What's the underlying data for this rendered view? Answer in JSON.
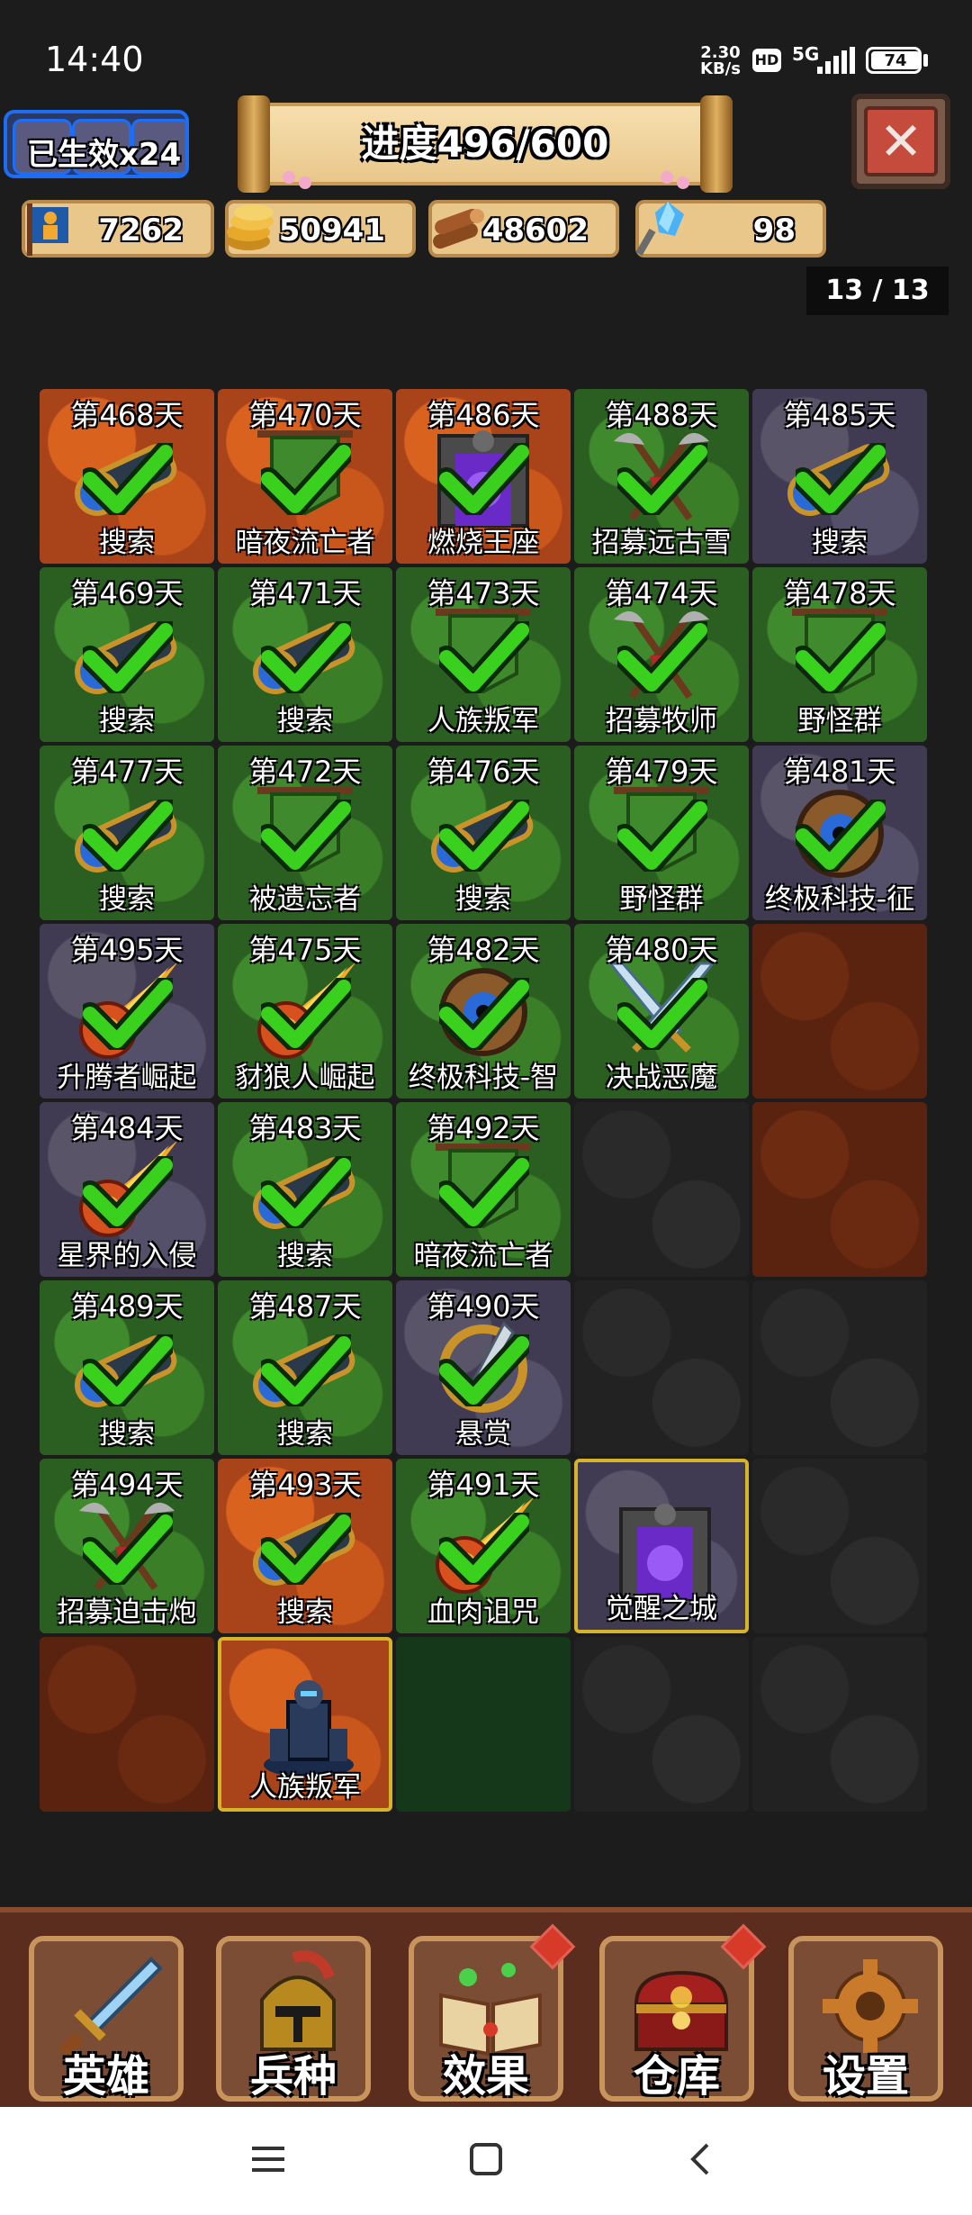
{
  "status_bar": {
    "time": "14:40",
    "net_speed_value": "2.30",
    "net_speed_unit": "KB/s",
    "hd": "HD",
    "network": "5G",
    "battery": "74"
  },
  "buffs": {
    "label": "已生效x24"
  },
  "progress": {
    "label": "进度496/600"
  },
  "resources": [
    {
      "icon": "population-icon",
      "value": "7262"
    },
    {
      "icon": "gold-icon",
      "value": "50941"
    },
    {
      "icon": "wood-icon",
      "value": "48602"
    },
    {
      "icon": "crystal-icon",
      "value": "98"
    }
  ],
  "page_indicator": "13 / 13",
  "tiles": [
    {
      "day": "第468天",
      "name": "搜索",
      "terrain": "lava",
      "icon": "spyglass-icon",
      "done": true
    },
    {
      "day": "第470天",
      "name": "暗夜流亡者",
      "terrain": "lava",
      "icon": "banner-icon",
      "done": true
    },
    {
      "day": "第486天",
      "name": "燃烧王座",
      "terrain": "lava",
      "icon": "portal-icon",
      "done": true
    },
    {
      "day": "第488天",
      "name": "招募远古雪",
      "terrain": "forest",
      "icon": "axes-icon",
      "done": true
    },
    {
      "day": "第485天",
      "name": "搜索",
      "terrain": "stone",
      "icon": "spyglass-icon",
      "done": true
    },
    {
      "day": "第469天",
      "name": "搜索",
      "terrain": "forest",
      "icon": "spyglass-icon",
      "done": true
    },
    {
      "day": "第471天",
      "name": "搜索",
      "terrain": "forest",
      "icon": "spyglass-icon",
      "done": true
    },
    {
      "day": "第473天",
      "name": "人族叛军",
      "terrain": "forest",
      "icon": "banner-icon",
      "done": true
    },
    {
      "day": "第474天",
      "name": "招募牧师",
      "terrain": "forest",
      "icon": "axes-icon",
      "done": true
    },
    {
      "day": "第478天",
      "name": "野怪群",
      "terrain": "forest",
      "icon": "banner-icon",
      "done": true
    },
    {
      "day": "第477天",
      "name": "搜索",
      "terrain": "forest",
      "icon": "spyglass-icon",
      "done": true
    },
    {
      "day": "第472天",
      "name": "被遗忘者",
      "terrain": "forest",
      "icon": "banner-icon",
      "done": true
    },
    {
      "day": "第476天",
      "name": "搜索",
      "terrain": "forest",
      "icon": "spyglass-icon",
      "done": true
    },
    {
      "day": "第479天",
      "name": "野怪群",
      "terrain": "forest",
      "icon": "banner-icon",
      "done": true
    },
    {
      "day": "第481天",
      "name": "终极科技-征",
      "terrain": "stone",
      "icon": "gear-icon",
      "done": true
    },
    {
      "day": "第495天",
      "name": "升腾者崛起",
      "terrain": "stone",
      "icon": "meteor-icon",
      "done": true
    },
    {
      "day": "第475天",
      "name": "豺狼人崛起",
      "terrain": "forest",
      "icon": "meteor-icon",
      "done": true
    },
    {
      "day": "第482天",
      "name": "终极科技-智",
      "terrain": "forest",
      "icon": "gear-icon",
      "done": true
    },
    {
      "day": "第480天",
      "name": "决战恶魔",
      "terrain": "forest",
      "icon": "swords-icon",
      "done": true
    },
    {
      "day": "",
      "name": "",
      "terrain": "darklava",
      "icon": "",
      "done": false
    },
    {
      "day": "第484天",
      "name": "星界的入侵",
      "terrain": "stone",
      "icon": "meteor-icon",
      "done": true
    },
    {
      "day": "第483天",
      "name": "搜索",
      "terrain": "forest",
      "icon": "spyglass-icon",
      "done": true
    },
    {
      "day": "第492天",
      "name": "暗夜流亡者",
      "terrain": "forest",
      "icon": "banner-icon",
      "done": true
    },
    {
      "day": "",
      "name": "",
      "terrain": "dark",
      "icon": "",
      "done": false
    },
    {
      "day": "",
      "name": "",
      "terrain": "darklava",
      "icon": "",
      "done": false
    },
    {
      "day": "第489天",
      "name": "搜索",
      "terrain": "forest",
      "icon": "spyglass-icon",
      "done": true
    },
    {
      "day": "第487天",
      "name": "搜索",
      "terrain": "forest",
      "icon": "spyglass-icon",
      "done": true
    },
    {
      "day": "第490天",
      "name": "悬赏",
      "terrain": "stone",
      "icon": "dagger-icon",
      "done": true
    },
    {
      "day": "",
      "name": "",
      "terrain": "dark",
      "icon": "",
      "done": false
    },
    {
      "day": "",
      "name": "",
      "terrain": "dark",
      "icon": "",
      "done": false
    },
    {
      "day": "第494天",
      "name": "招募迫击炮",
      "terrain": "forest",
      "icon": "axes-icon",
      "done": true
    },
    {
      "day": "第493天",
      "name": "搜索",
      "terrain": "lava",
      "icon": "spyglass-icon",
      "done": true
    },
    {
      "day": "第491天",
      "name": "血肉诅咒",
      "terrain": "forest",
      "icon": "meteor-icon",
      "done": true
    },
    {
      "day": "",
      "name": "觉醒之城",
      "terrain": "stone",
      "icon": "portal-icon",
      "done": false,
      "selected": true
    },
    {
      "day": "",
      "name": "",
      "terrain": "dark",
      "icon": "",
      "done": false
    },
    {
      "day": "",
      "name": "",
      "terrain": "darklava",
      "icon": "",
      "done": false
    },
    {
      "day": "",
      "name": "人族叛军",
      "terrain": "lava",
      "icon": "knight-icon",
      "done": false,
      "selected": true
    },
    {
      "day": "",
      "name": "",
      "terrain": "darkforest",
      "icon": "",
      "done": false
    },
    {
      "day": "",
      "name": "",
      "terrain": "dark",
      "icon": "",
      "done": false
    },
    {
      "day": "",
      "name": "",
      "terrain": "dark",
      "icon": "",
      "done": false
    }
  ],
  "nav": [
    {
      "label": "英雄",
      "icon": "sword-icon",
      "badge": false
    },
    {
      "label": "兵种",
      "icon": "helmet-icon",
      "badge": false
    },
    {
      "label": "效果",
      "icon": "spellbook-icon",
      "badge": true
    },
    {
      "label": "仓库",
      "icon": "chest-icon",
      "badge": true
    },
    {
      "label": "设置",
      "icon": "settings-gear-icon",
      "badge": false
    }
  ]
}
